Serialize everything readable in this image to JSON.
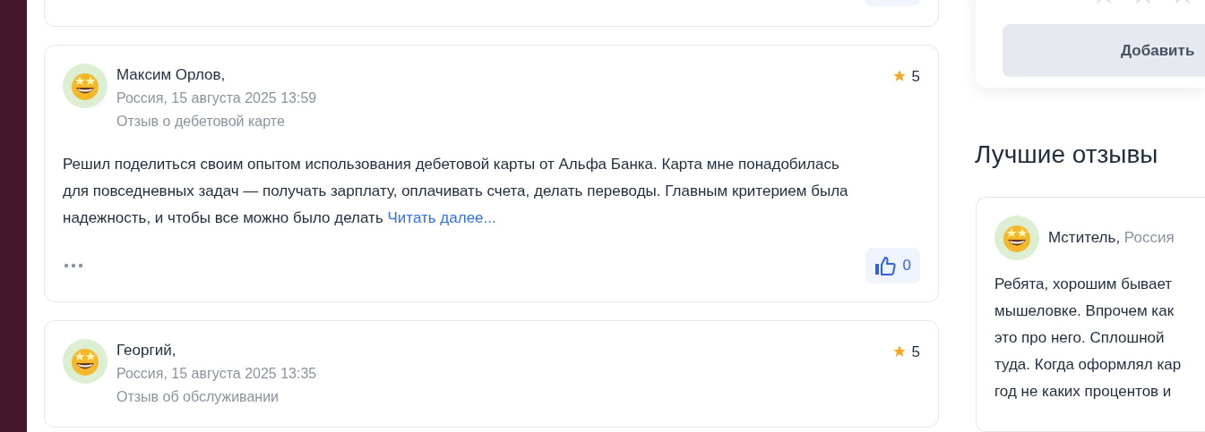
{
  "rating_card": {
    "stars": 0,
    "button": "Добавить"
  },
  "reviews": [
    {
      "name": "Максим Орлов,",
      "meta": "Россия, 15 августа 2025 13:59",
      "topic": "Отзыв о дебетовой карте",
      "rating": "5",
      "text": "Решил поделиться своим опытом использования дебетовой карты от Альфа Банка. Карта мне понадобилась для повседневных задач — получать зарплату, оплачивать счета, делать переводы. Главным критерием была надежность, и чтобы все можно было делать",
      "read_more": "Читать далее...",
      "likes": "0"
    },
    {
      "name": "Георгий,",
      "meta": "Россия, 15 августа 2025 13:35",
      "topic": "Отзыв об обслуживании",
      "rating": "5"
    }
  ],
  "best_reviews": {
    "title": "Лучшие отзывы",
    "items": [
      {
        "name": "Мститель,",
        "country": "Россия",
        "lines": [
          "Ребята, хорошим бывает",
          "мышеловке. Впрочем как",
          "это про него. Сплошной",
          "туда. Когда оформлял кар",
          "год не каких процентов и"
        ]
      }
    ]
  }
}
